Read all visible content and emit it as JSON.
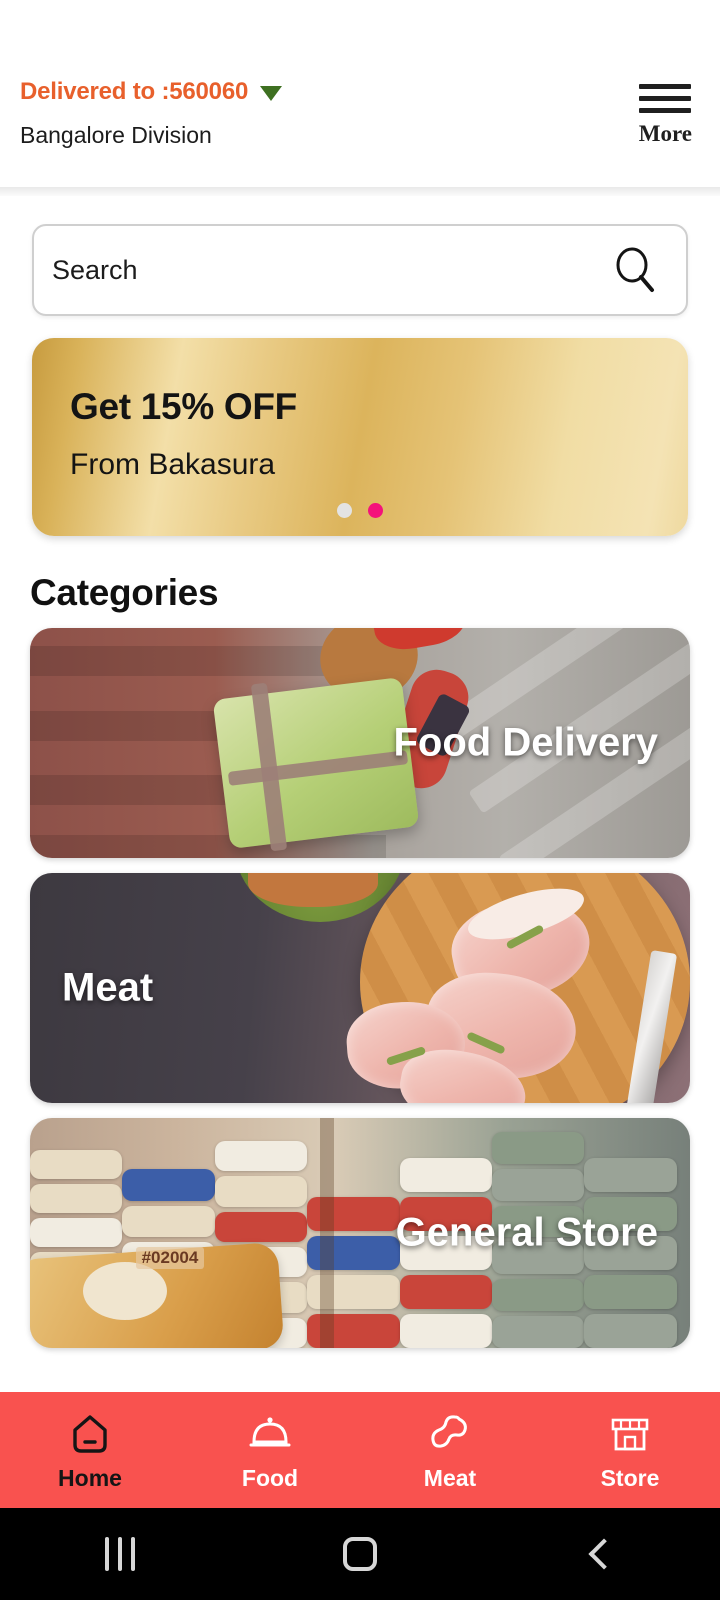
{
  "header": {
    "delivered_label": "Delivered to :560060",
    "region": "Bangalore Division",
    "more_label": "More",
    "caret_icon": "caret-down-icon",
    "menu_icon": "hamburger-menu-icon",
    "accent_color": "#E8602C",
    "caret_color": "#3E7021"
  },
  "search": {
    "placeholder": "Search",
    "value": "",
    "icon": "search-icon"
  },
  "promo": {
    "title": "Get 15% OFF",
    "subtitle": "From Bakasura",
    "dots": [
      {
        "state": "inactive",
        "color": "#e3e3e3"
      },
      {
        "state": "active",
        "color": "#f4127b"
      }
    ]
  },
  "categories": {
    "heading": "Categories",
    "items": [
      {
        "label": "Food Delivery",
        "align": "right",
        "art": "food-delivery-image"
      },
      {
        "label": "Meat",
        "align": "left",
        "art": "meat-image"
      },
      {
        "label": "General Store",
        "align": "right",
        "art": "general-store-image"
      }
    ],
    "store_tag": "#02004"
  },
  "bottom_nav": {
    "background": "#F9524F",
    "items": [
      {
        "label": "Home",
        "icon": "home-icon",
        "active": true
      },
      {
        "label": "Food",
        "icon": "food-cloche-icon",
        "active": false
      },
      {
        "label": "Meat",
        "icon": "drumstick-icon",
        "active": false
      },
      {
        "label": "Store",
        "icon": "storefront-icon",
        "active": false
      }
    ]
  },
  "system_bar": {
    "recents_icon": "recents-icon",
    "home_icon": "android-home-icon",
    "back_icon": "back-icon"
  }
}
